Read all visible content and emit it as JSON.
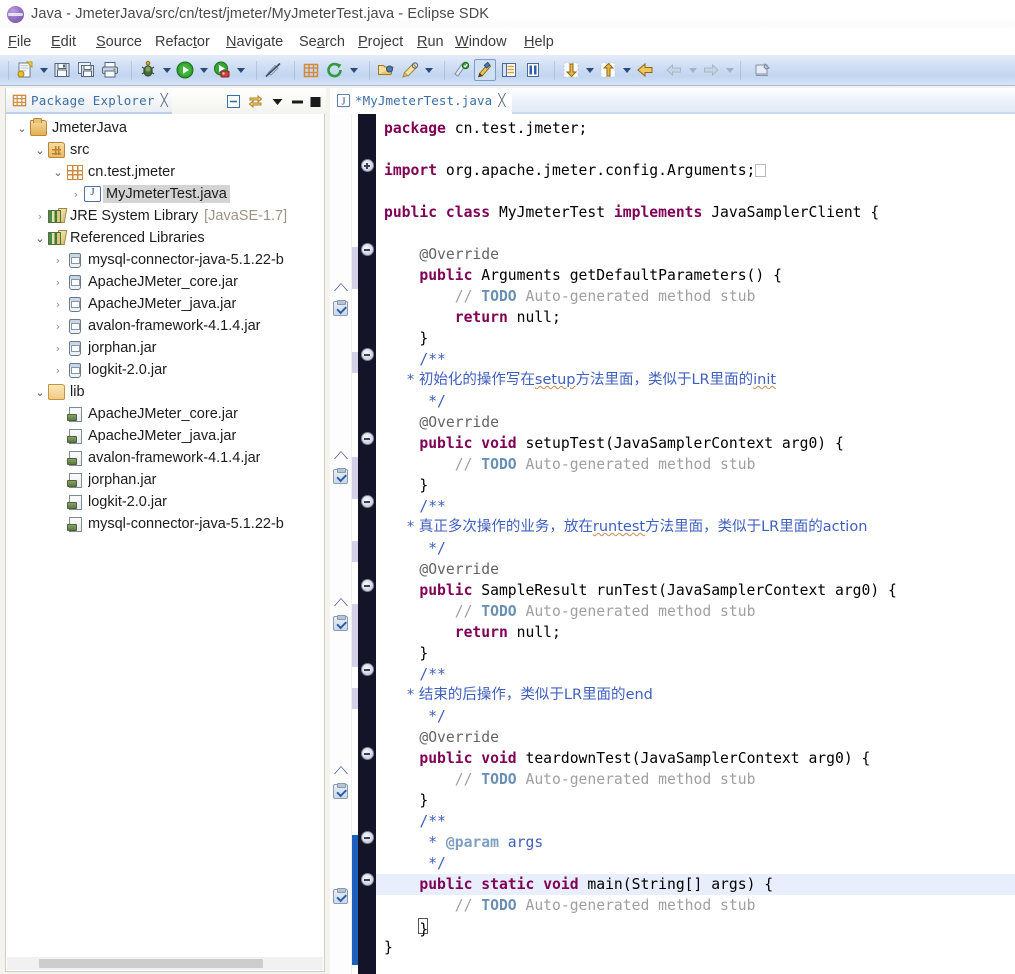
{
  "window": {
    "title": "Java - JmeterJava/src/cn/test/jmeter/MyJmeterTest.java - Eclipse SDK",
    "app_icon": "eclipse-icon"
  },
  "menubar": {
    "items": [
      {
        "label": "File",
        "mnemonic": "F"
      },
      {
        "label": "Edit",
        "mnemonic": "E"
      },
      {
        "label": "Source",
        "mnemonic": "S"
      },
      {
        "label": "Refactor",
        "mnemonic": "t"
      },
      {
        "label": "Navigate",
        "mnemonic": "N"
      },
      {
        "label": "Search",
        "mnemonic": "a"
      },
      {
        "label": "Project",
        "mnemonic": "P"
      },
      {
        "label": "Run",
        "mnemonic": "R"
      },
      {
        "label": "Window",
        "mnemonic": "W"
      },
      {
        "label": "Help",
        "mnemonic": "H"
      }
    ]
  },
  "toolbar": {
    "buttons": [
      {
        "name": "new-wizard-button",
        "icon": "new-file-icon",
        "dropdown": true
      },
      {
        "name": "save-button",
        "icon": "save-icon",
        "dropdown": false
      },
      {
        "name": "save-all-button",
        "icon": "save-all-icon",
        "dropdown": false
      },
      {
        "name": "print-button",
        "icon": "print-icon",
        "dropdown": false
      },
      {
        "name": "debug-button",
        "icon": "debug-bug-icon",
        "dropdown": true
      },
      {
        "name": "run-button",
        "icon": "run-play-icon",
        "dropdown": true
      },
      {
        "name": "external-tools-button",
        "icon": "external-tools-icon",
        "dropdown": true
      },
      {
        "name": "skip-breakpoints-button",
        "icon": "skip-breakpoints-icon",
        "dropdown": false
      },
      {
        "name": "new-java-package-button",
        "icon": "new-package-icon",
        "dropdown": false
      },
      {
        "name": "new-java-class-button",
        "icon": "new-class-icon",
        "dropdown": true
      },
      {
        "name": "open-type-button",
        "icon": "open-type-icon",
        "dropdown": false
      },
      {
        "name": "search-button",
        "icon": "search-icon",
        "dropdown": true
      },
      {
        "name": "toggle-mark-occurrences",
        "icon": "mark-occurrences-icon",
        "dropdown": false
      },
      {
        "name": "java-perspective-button",
        "icon": "java-perspective-icon",
        "dropdown": false
      },
      {
        "name": "outline-button",
        "icon": "outline-view-icon",
        "dropdown": false
      },
      {
        "name": "task-list-button",
        "icon": "task-list-icon",
        "dropdown": false
      },
      {
        "name": "next-annotation-button",
        "icon": "next-annotation-icon",
        "dropdown": true
      },
      {
        "name": "prev-annotation-button",
        "icon": "prev-annotation-icon",
        "dropdown": true
      },
      {
        "name": "last-edit-location-button",
        "icon": "last-edit-icon",
        "dropdown": false
      },
      {
        "name": "back-button",
        "icon": "arrow-left-icon",
        "dropdown": true,
        "disabled": true
      },
      {
        "name": "forward-button",
        "icon": "arrow-right-icon",
        "dropdown": true,
        "disabled": true
      },
      {
        "name": "pin-editor-button",
        "icon": "pin-editor-icon",
        "dropdown": false
      }
    ]
  },
  "package_explorer": {
    "tab_label": "Package Explorer",
    "tab_icon": "package-explorer-icon",
    "close_glyph": "╳",
    "view_tools": [
      {
        "name": "collapse-all-button",
        "icon": "collapse-all-icon"
      },
      {
        "name": "link-with-editor-button",
        "icon": "link-editor-icon"
      },
      {
        "name": "view-menu-button",
        "icon": "chevron-down-icon"
      },
      {
        "name": "minimize-view-button",
        "icon": "minimize-icon"
      },
      {
        "name": "maximize-view-button",
        "icon": "maximize-icon"
      }
    ],
    "tree": [
      {
        "label": "JmeterJava",
        "indent": 0,
        "twist": "expanded",
        "icon": "java-project-icon",
        "selected": false
      },
      {
        "label": "src",
        "indent": 1,
        "twist": "expanded",
        "icon": "source-folder-icon",
        "selected": false
      },
      {
        "label": "cn.test.jmeter",
        "indent": 2,
        "twist": "expanded",
        "icon": "package-icon",
        "selected": false
      },
      {
        "label": "MyJmeterTest.java",
        "indent": 3,
        "twist": "collapsed",
        "icon": "java-file-icon",
        "selected": true
      },
      {
        "label": "JRE System Library",
        "indent": 1,
        "twist": "collapsed",
        "icon": "library-icon",
        "selected": false,
        "suffix": "[JavaSE-1.7]"
      },
      {
        "label": "Referenced Libraries",
        "indent": 1,
        "twist": "expanded",
        "icon": "library-icon",
        "selected": false
      },
      {
        "label": "mysql-connector-java-5.1.22-b",
        "indent": 2,
        "twist": "collapsed",
        "icon": "jar-icon",
        "selected": false
      },
      {
        "label": "ApacheJMeter_core.jar",
        "indent": 2,
        "twist": "collapsed",
        "icon": "jar-icon",
        "selected": false
      },
      {
        "label": "ApacheJMeter_java.jar",
        "indent": 2,
        "twist": "collapsed",
        "icon": "jar-icon",
        "selected": false
      },
      {
        "label": "avalon-framework-4.1.4.jar",
        "indent": 2,
        "twist": "collapsed",
        "icon": "jar-icon",
        "selected": false
      },
      {
        "label": "jorphan.jar",
        "indent": 2,
        "twist": "collapsed",
        "icon": "jar-icon",
        "selected": false
      },
      {
        "label": "logkit-2.0.jar",
        "indent": 2,
        "twist": "collapsed",
        "icon": "jar-icon",
        "selected": false
      },
      {
        "label": "lib",
        "indent": 1,
        "twist": "expanded",
        "icon": "folder-icon",
        "selected": false
      },
      {
        "label": "ApacheJMeter_core.jar",
        "indent": 2,
        "twist": "none",
        "icon": "file-jar-icon",
        "selected": false
      },
      {
        "label": "ApacheJMeter_java.jar",
        "indent": 2,
        "twist": "none",
        "icon": "file-jar-icon",
        "selected": false
      },
      {
        "label": "avalon-framework-4.1.4.jar",
        "indent": 2,
        "twist": "none",
        "icon": "file-jar-icon",
        "selected": false
      },
      {
        "label": "jorphan.jar",
        "indent": 2,
        "twist": "none",
        "icon": "file-jar-icon",
        "selected": false
      },
      {
        "label": "logkit-2.0.jar",
        "indent": 2,
        "twist": "none",
        "icon": "file-jar-icon",
        "selected": false
      },
      {
        "label": "mysql-connector-java-5.1.22-b",
        "indent": 2,
        "twist": "none",
        "icon": "file-jar-icon",
        "selected": false
      }
    ]
  },
  "editor": {
    "tab_label": "*MyJmeterTest.java",
    "tab_icon": "java-file-icon",
    "close_glyph": "╳",
    "dirty": true,
    "code_lines": [
      {
        "t": "package",
        "hl": false
      },
      {
        "t": "blank"
      },
      {
        "t": "import"
      },
      {
        "t": "blank"
      },
      {
        "t": "class"
      },
      {
        "t": "blank"
      },
      {
        "t": "override1"
      },
      {
        "t": "m1sig"
      },
      {
        "t": "todo1"
      },
      {
        "t": "ret1"
      },
      {
        "t": "close1"
      },
      {
        "t": "jdoc_open1"
      },
      {
        "t": "jdoc_cn1"
      },
      {
        "t": "jdoc_close1"
      },
      {
        "t": "override2"
      },
      {
        "t": "m2sig"
      },
      {
        "t": "todo2"
      },
      {
        "t": "close2"
      },
      {
        "t": "jdoc_open2"
      },
      {
        "t": "jdoc_cn2"
      },
      {
        "t": "jdoc_close2"
      },
      {
        "t": "override3"
      },
      {
        "t": "m3sig"
      },
      {
        "t": "todo3"
      },
      {
        "t": "ret3"
      },
      {
        "t": "close3"
      },
      {
        "t": "jdoc_open3"
      },
      {
        "t": "jdoc_cn3"
      },
      {
        "t": "jdoc_close3"
      },
      {
        "t": "override4"
      },
      {
        "t": "m4sig"
      },
      {
        "t": "todo4"
      },
      {
        "t": "close4"
      },
      {
        "t": "jdoc_open4"
      },
      {
        "t": "jdoc_param"
      },
      {
        "t": "jdoc_close4"
      },
      {
        "t": "mainsig",
        "hl": true
      },
      {
        "t": "todo5"
      },
      {
        "t": "close5"
      },
      {
        "t": "classclose"
      }
    ],
    "text": {
      "kw_package": "package",
      "pkg_name": " cn.test.jmeter;",
      "kw_import": "import",
      "import_name": " org.apache.jmeter.config.Arguments;",
      "kw_public": "public",
      "kw_class": "class",
      "class_name": " MyJmeterTest ",
      "kw_implements": "implements",
      "interface_name": " JavaSamplerClient {",
      "annot_override": "@Override",
      "m1_ret": " Arguments getDefaultParameters() {",
      "m2_ret": " setupTest(JavaSamplerContext arg0) {",
      "m3_ret": " SampleResult runTest(JavaSamplerContext arg0) {",
      "m4_ret": " teardownTest(JavaSamplerContext arg0) {",
      "kw_void": "void",
      "kw_static": "static",
      "main_sig": " main(String[] args) {",
      "todo_slashes": "// ",
      "todo_word": "TODO",
      "todo_rest": " Auto-generated method stub",
      "kw_return": "return",
      "null_semi": " null;",
      "brace_close": "}",
      "jdoc_open": "/**",
      "jdoc_close": " */",
      "jdoc_star": " * ",
      "cn_comment_1_a": "初始化的操作写在",
      "cn_comment_1_b": "setup",
      "cn_comment_1_c": "方法里面，类似于",
      "cn_comment_1_d": "LR",
      "cn_comment_1_e": "里面的",
      "cn_comment_1_f": "init",
      "cn_comment_2_a": "真正多次操作的业务，放在",
      "cn_comment_2_b": "runtest",
      "cn_comment_2_c": "方法里面，类似于",
      "cn_comment_2_d": "LR",
      "cn_comment_2_e": "里面的",
      "cn_comment_2_f": "action",
      "cn_comment_3_a": "结束的后操作，类似于",
      "cn_comment_3_b": "LR",
      "cn_comment_3_c": "里面的",
      "cn_comment_3_d": "end",
      "jdoc_param_tag": "@param",
      "jdoc_param_name": " args"
    }
  },
  "colors": {
    "keyword": "#7f0055",
    "javadoc": "#3f5fbf",
    "comment_gray": "#a0a0a0",
    "todo_blue": "#6a8fb5",
    "tab_link": "#3b6ea5",
    "selection_line": "#e8eefb",
    "fold_ruler": "#141428",
    "toolbar_top": "#e4ecfa",
    "toolbar_bottom": "#d6e4f8"
  }
}
